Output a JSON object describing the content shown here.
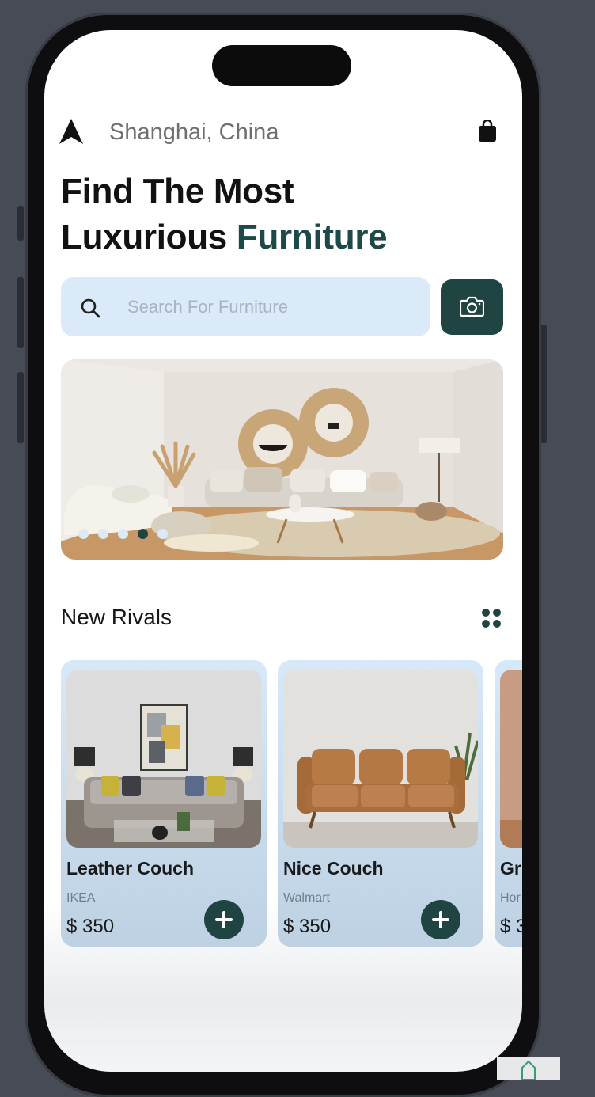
{
  "header": {
    "location": "Shanghai, China"
  },
  "hero": {
    "line1": "Find The Most",
    "line2_plain": "Luxurious ",
    "line2_accent": "Furniture"
  },
  "search": {
    "placeholder": "Search For Furniture"
  },
  "banner": {
    "slide_count": 5,
    "active_slide": 4
  },
  "section": {
    "title": "New Rivals"
  },
  "products": [
    {
      "name": "Leather Couch",
      "brand": "IKEA",
      "price": "$ 350"
    },
    {
      "name": "Nice Couch",
      "brand": "Walmart",
      "price": "$ 350"
    },
    {
      "name": "Gr",
      "brand": "Hor",
      "price": "$ 3"
    }
  ],
  "colors": {
    "accent": "#1d4a47",
    "button": "#1f4441",
    "search_bg": "#dbeaf8",
    "card_bg": "#cfe2f4"
  },
  "icons": [
    "navigation-arrow-icon",
    "shopping-bag-icon",
    "search-icon",
    "camera-icon",
    "grid-icon",
    "plus-icon"
  ]
}
